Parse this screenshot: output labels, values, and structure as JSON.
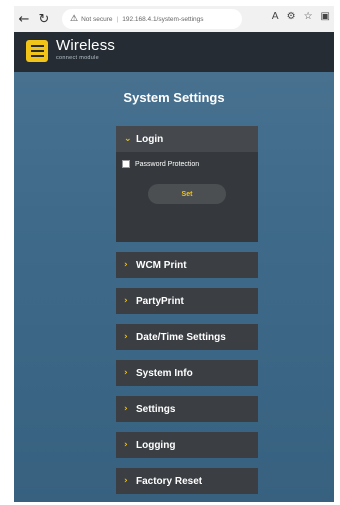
{
  "browser": {
    "url_warning": "Not secure",
    "url": "192.168.4.1/system-settings",
    "icons": [
      "back-arrow-icon",
      "refresh-icon",
      "warning-icon",
      "read-aloud-icon",
      "extensions-icon",
      "favorites-icon",
      "collections-icon"
    ]
  },
  "header": {
    "brand": "Wireless",
    "tagline": "connect module",
    "accent_color": "#f0c419"
  },
  "page": {
    "title": "System Settings"
  },
  "login": {
    "label": "Login",
    "expanded": true,
    "password_protection_label": "Password Protection",
    "password_protection_checked": false,
    "set_label": "Set"
  },
  "sections": [
    {
      "label": "WCM Print",
      "expanded": false
    },
    {
      "label": "PartyPrint",
      "expanded": false
    },
    {
      "label": "Date/Time Settings",
      "expanded": false
    },
    {
      "label": "System Info",
      "expanded": false
    },
    {
      "label": "Settings",
      "expanded": false
    },
    {
      "label": "Logging",
      "expanded": false
    },
    {
      "label": "Factory Reset",
      "expanded": false
    }
  ]
}
